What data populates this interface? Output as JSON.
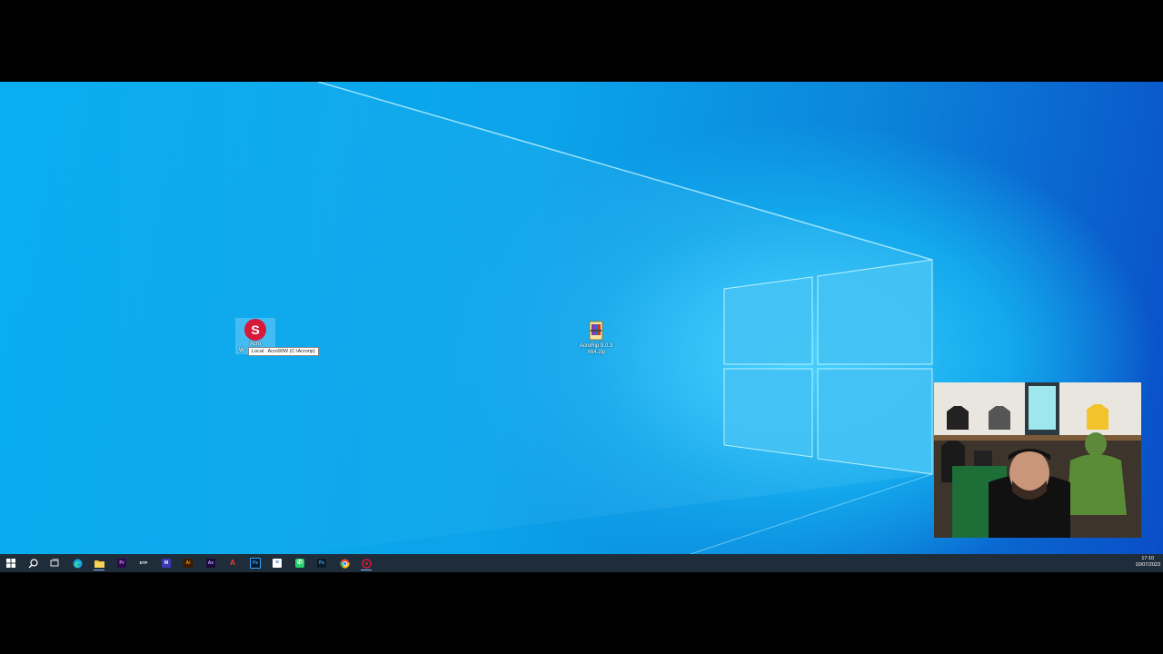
{
  "desktop": {
    "icons": [
      {
        "label": "Acro",
        "sublabel": "W",
        "icon": "acrorip-s-logo-icon",
        "color": "#d7193a"
      },
      {
        "label": "AcroRip 9.0.3",
        "sublabel": "X64.zip",
        "icon": "winrar-archive-icon"
      }
    ],
    "tooltip": {
      "location_label": "Local",
      "location_value": "Acro90W (C:\\Acrorip)"
    }
  },
  "taskbar": {
    "buttons": [
      {
        "name": "start",
        "icon": "windows-start-icon"
      },
      {
        "name": "search",
        "icon": "search-icon"
      },
      {
        "name": "task-view",
        "icon": "task-view-icon"
      },
      {
        "name": "edge",
        "icon": "edge-icon",
        "color": "#1aa0e8"
      },
      {
        "name": "file-explorer",
        "icon": "folder-icon",
        "color": "#f5c33b"
      },
      {
        "name": "premiere",
        "icon": "premiere-icon",
        "text": "Pr",
        "color": "#2a0a4a",
        "fg": "#e08cff"
      },
      {
        "name": "dtf",
        "icon": "dtf-icon",
        "text": "DTF",
        "color": "#1f2d3a",
        "fg": "#ffffff"
      },
      {
        "name": "app-blue",
        "icon": "app-icon",
        "text": "M",
        "color": "#3a3ab0",
        "fg": "#ffffff"
      },
      {
        "name": "illustrator",
        "icon": "illustrator-icon",
        "text": "Ai",
        "color": "#3a1a00",
        "fg": "#ff9a00"
      },
      {
        "name": "after-effects",
        "icon": "after-effects-icon",
        "text": "Ae",
        "color": "#1a0a3a",
        "fg": "#c39bff"
      },
      {
        "name": "acrobat",
        "icon": "acrobat-icon",
        "text": "A",
        "color": "#1f2d3a",
        "fg": "#ff3a30"
      },
      {
        "name": "photoshop-1",
        "icon": "photoshop-icon",
        "text": "Ps",
        "color": "#0a1a2a",
        "fg": "#31a8ff"
      },
      {
        "name": "notes",
        "icon": "notes-icon",
        "text": "≡",
        "color": "#ffffff",
        "fg": "#2a6bd8"
      },
      {
        "name": "whatsapp",
        "icon": "whatsapp-icon",
        "text": "✆",
        "color": "#25d366",
        "fg": "#ffffff"
      },
      {
        "name": "photoshop-2",
        "icon": "photoshop-icon",
        "text": "Ps",
        "color": "#0a1a2a",
        "fg": "#31a8ff"
      },
      {
        "name": "chrome",
        "icon": "chrome-icon",
        "color": "#e94235"
      },
      {
        "name": "acrorip",
        "icon": "acrorip-icon",
        "color": "#d7193a"
      }
    ],
    "clock": {
      "time": "17:10",
      "date": "10/07/2023"
    }
  }
}
